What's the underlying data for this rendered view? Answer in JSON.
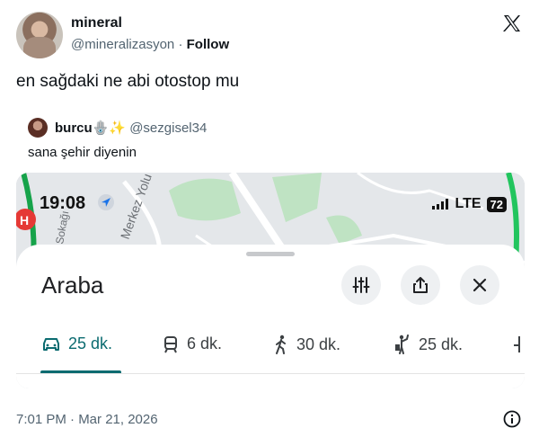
{
  "tweet": {
    "author_name": "mineral",
    "author_handle": "@mineralizasyon",
    "separator": "·",
    "follow_label": "Follow",
    "text": "en sağdaki ne abi otostop mu",
    "timestamp": "7:01 PM · Mar 21, 2026"
  },
  "quote": {
    "author_name": "burcu🪬✨",
    "author_handle": "@sezgisel34",
    "text": "sana şehir diyenin"
  },
  "media": {
    "status_time": "19:08",
    "network": "LTE",
    "battery": "72",
    "map_labels": [
      "Merkez Yolu",
      "Sokağı"
    ],
    "sheet": {
      "title": "Araba",
      "buttons": [
        "sliders-icon",
        "share-icon",
        "close-icon"
      ],
      "tabs": [
        {
          "icon": "car-icon",
          "label": "25 dk.",
          "active": true
        },
        {
          "icon": "train-icon",
          "label": "6 dk.",
          "active": false
        },
        {
          "icon": "walk-icon",
          "label": "30 dk.",
          "active": false
        },
        {
          "icon": "hitchhike-icon",
          "label": "25 dk.",
          "active": false
        }
      ]
    }
  },
  "colors": {
    "accent": "#0b6b70",
    "secondary_text": "#536471",
    "map_green": "#bfe3c3"
  }
}
